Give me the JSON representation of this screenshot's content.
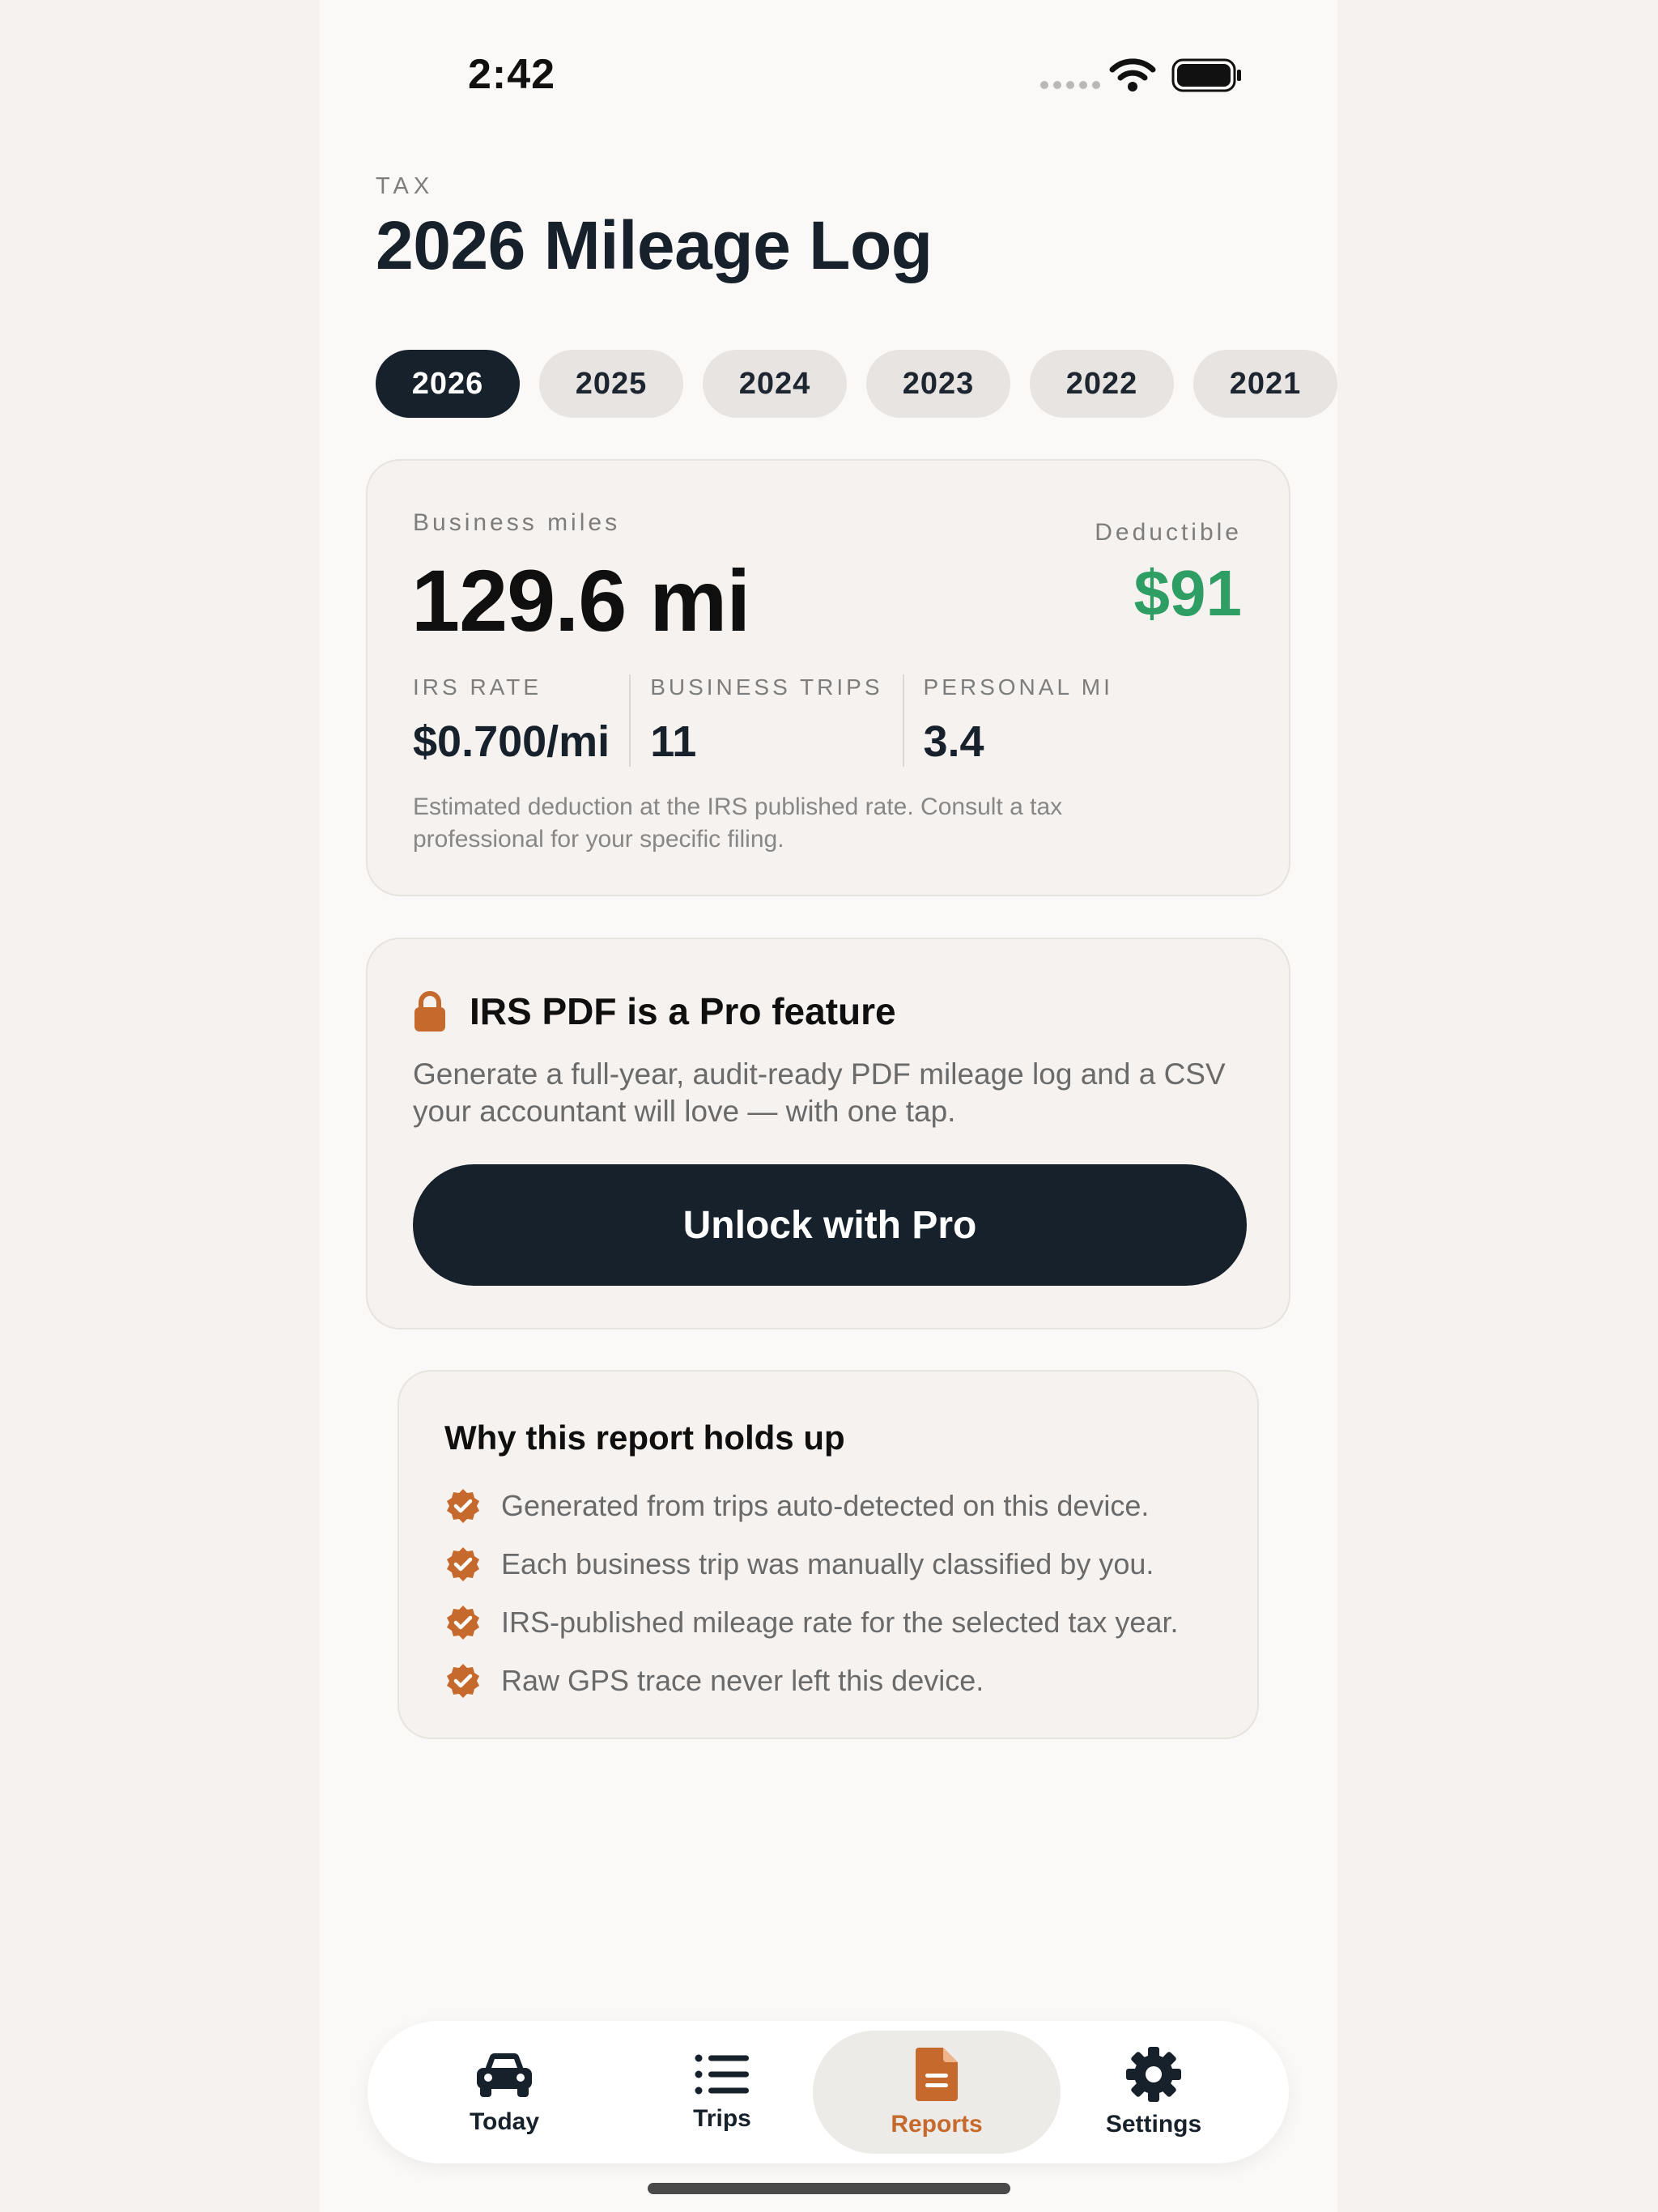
{
  "status_bar": {
    "time": "2:42"
  },
  "header": {
    "eyebrow": "TAX",
    "title": "2026 Mileage Log"
  },
  "years": [
    {
      "label": "2026",
      "active": true
    },
    {
      "label": "2025",
      "active": false
    },
    {
      "label": "2024",
      "active": false
    },
    {
      "label": "2023",
      "active": false
    },
    {
      "label": "2022",
      "active": false
    },
    {
      "label": "2021",
      "active": false
    }
  ],
  "summary": {
    "business_miles_label": "Business miles",
    "business_miles_value": "129.6 mi",
    "deductible_label": "Deductible",
    "deductible_value": "$91",
    "stats": [
      {
        "label": "IRS RATE",
        "value": "$0.700/mi"
      },
      {
        "label": "BUSINESS TRIPS",
        "value": "11"
      },
      {
        "label": "PERSONAL MI",
        "value": "3.4"
      }
    ],
    "note": "Estimated deduction at the IRS published rate. Consult a tax professional for your specific filing."
  },
  "pro": {
    "title": "IRS PDF is a Pro feature",
    "description": "Generate a full-year, audit-ready PDF mileage log and a CSV your accountant will love — with one tap.",
    "button_label": "Unlock with Pro",
    "icon": "lock-icon"
  },
  "why": {
    "title": "Why this report holds up",
    "items": [
      "Generated from trips auto-detected on this device.",
      "Each business trip was manually classified by you.",
      "IRS-published mileage rate for the selected tax year.",
      "Raw GPS trace never left this device."
    ],
    "icon": "check-badge-icon"
  },
  "tabs": [
    {
      "label": "Today",
      "icon": "car-icon",
      "active": false
    },
    {
      "label": "Trips",
      "icon": "list-icon",
      "active": false
    },
    {
      "label": "Reports",
      "icon": "document-icon",
      "active": true
    },
    {
      "label": "Settings",
      "icon": "gear-icon",
      "active": false
    }
  ],
  "colors": {
    "accent": "#c56a2c",
    "primary_dark": "#17212b",
    "deductible_green": "#2f9e64",
    "background": "#f5f2ef"
  }
}
